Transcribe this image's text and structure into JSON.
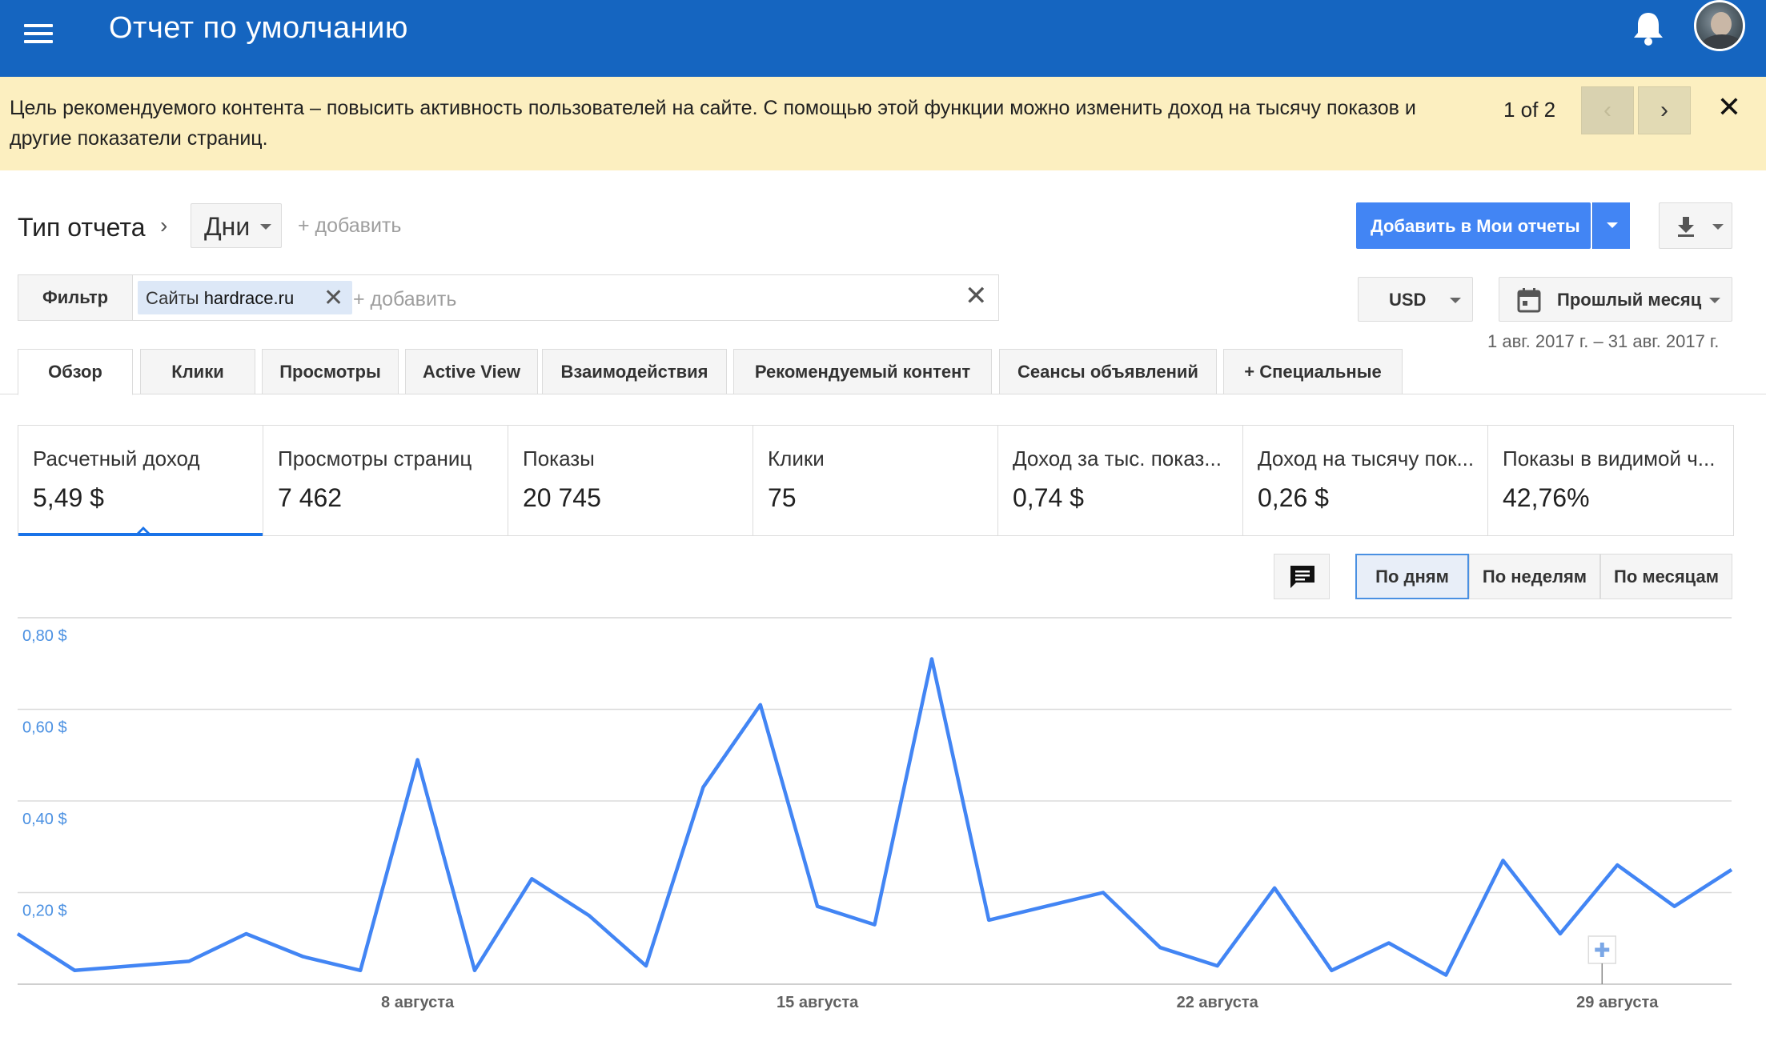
{
  "header": {
    "title": "Отчет по умолчанию",
    "menu_icon": "hamburger-menu-icon",
    "bell_icon": "bell-icon"
  },
  "notice": {
    "text": "Цель рекомендуемого контента – повысить активность пользователей на сайте. С помощью этой функции можно изменить доход на тысячу показов и другие показатели страниц.",
    "pager": "1 of 2",
    "prev_label": "‹",
    "next_label": "›",
    "close_label": "✕"
  },
  "report_type": {
    "label": "Тип отчета",
    "chevron": "›",
    "dimension": "Дни",
    "add_label": "+ добавить"
  },
  "actions": {
    "add_to_reports": "Добавить в Мои отчеты"
  },
  "filter": {
    "label": "Фильтр",
    "chip_prefix": "Сайты",
    "chip_value": "hardrace.ru",
    "chip_close": "✕",
    "add_placeholder": "+ добавить",
    "clear": "✕"
  },
  "currency": "USD",
  "date": {
    "preset": "Прошлый месяц",
    "range": "1 авг. 2017 г. – 31 авг. 2017 г."
  },
  "tabs": [
    {
      "label": "Обзор",
      "active": true
    },
    {
      "label": "Клики"
    },
    {
      "label": "Просмотры"
    },
    {
      "label": "Active View"
    },
    {
      "label": "Взаимодействия"
    },
    {
      "label": "Рекомендуемый контент"
    },
    {
      "label": "Сеансы объявлений"
    },
    {
      "label": "+ Специальные"
    }
  ],
  "metrics": [
    {
      "label": "Расчетный доход",
      "value": "5,49 $",
      "active": true
    },
    {
      "label": "Просмотры страниц",
      "value": "7 462"
    },
    {
      "label": "Показы",
      "value": "20 745"
    },
    {
      "label": "Клики",
      "value": "75"
    },
    {
      "label": "Доход за тыс. показ...",
      "value": "0,74 $"
    },
    {
      "label": "Доход на тысячу пок...",
      "value": "0,26 $"
    },
    {
      "label": "Показы в видимой ч...",
      "value": "42,76%"
    }
  ],
  "granularity": {
    "day": "По дням",
    "week": "По неделям",
    "month": "По месяцам",
    "selected": "day"
  },
  "chart_data": {
    "type": "line",
    "ylim": [
      0,
      0.8
    ],
    "y_ticks": [
      {
        "value": 0.8,
        "label": "0,80 $"
      },
      {
        "value": 0.6,
        "label": "0,60 $"
      },
      {
        "value": 0.4,
        "label": "0,40 $"
      },
      {
        "value": 0.2,
        "label": "0,20 $"
      }
    ],
    "x_ticks": [
      {
        "day": 8,
        "label": "8 августа"
      },
      {
        "day": 15,
        "label": "15 августа"
      },
      {
        "day": 22,
        "label": "22 августа"
      },
      {
        "day": 29,
        "label": "29 августа"
      }
    ],
    "color": "#4285f4",
    "series": [
      {
        "x": [
          1,
          2,
          3,
          4,
          5,
          6,
          7,
          8,
          9,
          10,
          11,
          12,
          13,
          14,
          15,
          16,
          17,
          18,
          19,
          20,
          21,
          22,
          23,
          24,
          25,
          26,
          27,
          28,
          29,
          30,
          31
        ],
        "values": [
          0.11,
          0.03,
          0.04,
          0.05,
          0.11,
          0.06,
          0.03,
          0.49,
          0.03,
          0.23,
          0.15,
          0.04,
          0.43,
          0.61,
          0.17,
          0.13,
          0.71,
          0.14,
          0.17,
          0.2,
          0.08,
          0.04,
          0.21,
          0.03,
          0.09,
          0.02,
          0.27,
          0.11,
          0.26,
          0.17,
          0.25
        ]
      }
    ]
  }
}
